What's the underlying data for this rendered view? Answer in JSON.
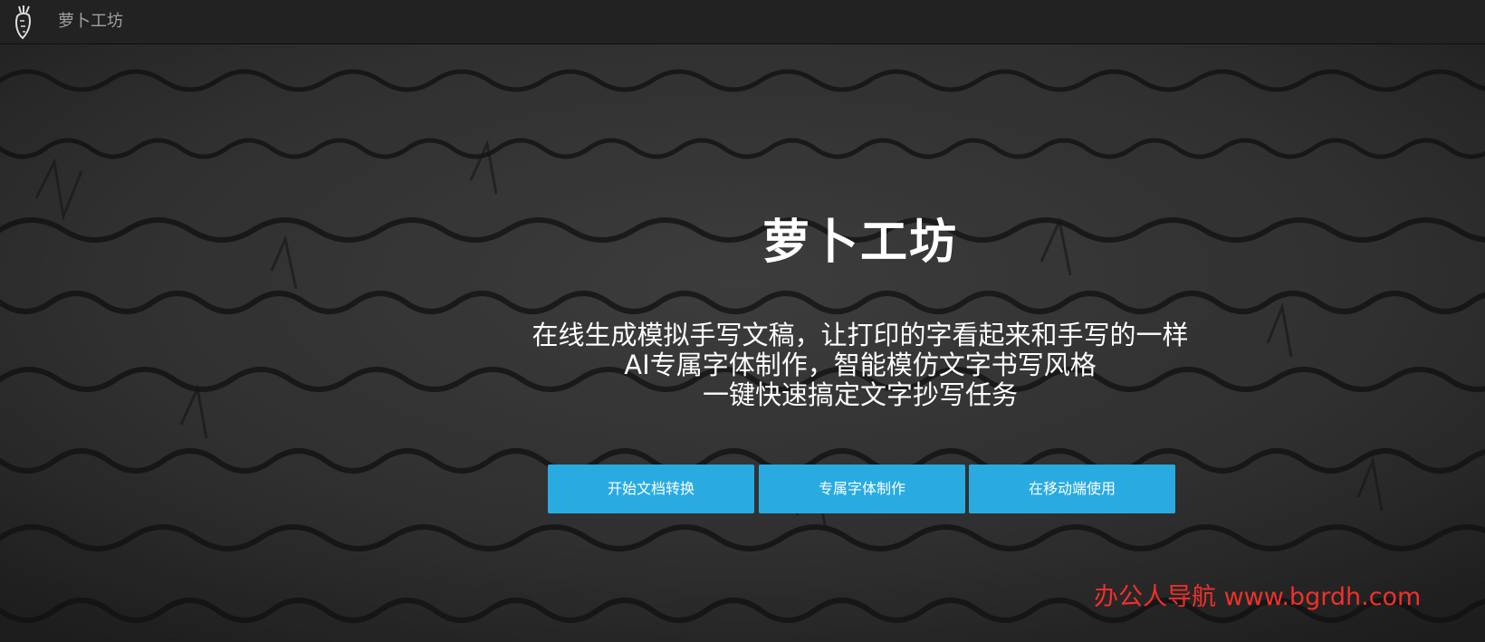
{
  "navbar": {
    "logo_icon": "carrot-icon",
    "brand": "萝卜工坊"
  },
  "hero": {
    "title": "萝卜工坊",
    "tagline_lines": [
      "在线生成模拟手写文稿，让打印的字看起来和手写的一样",
      "AI专属字体制作，智能模仿文字书写风格",
      "一键快速搞定文字抄写任务"
    ],
    "buttons": [
      {
        "label": "开始文档转换"
      },
      {
        "label": "专属字体制作"
      },
      {
        "label": "在移动端使用"
      }
    ],
    "background_description_icon": "handwriting-paper-background"
  },
  "watermark": "办公人导航 www.bgrdh.com",
  "colors": {
    "navbar_bg": "#222222",
    "button_bg": "#29abe2",
    "watermark": "#f0302a"
  }
}
